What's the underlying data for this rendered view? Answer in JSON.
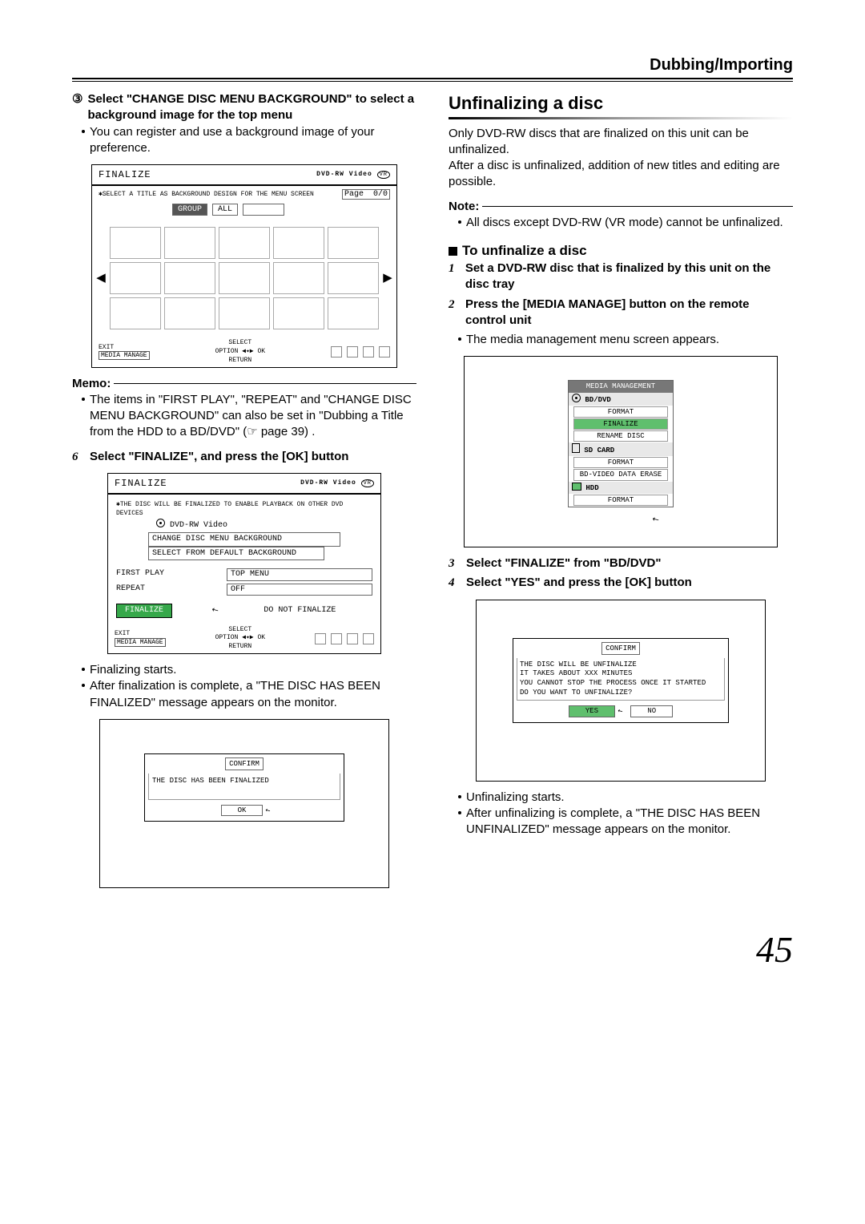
{
  "header": {
    "section": "Dubbing/Importing"
  },
  "left": {
    "step3_num": "③",
    "step3_text": "Select \"CHANGE DISC MENU BACKGROUND\" to  select a background image for the top menu",
    "step3_note": "You can register and use a background image of your preference.",
    "shot1": {
      "title": "FINALIZE",
      "badge": "DVD-RW Video",
      "note": "✱SELECT A TITLE AS BACKGROUND DESIGN FOR THE MENU SCREEN",
      "groupBtn": "GROUP",
      "allBtn": "ALL",
      "pageLabel": "Page",
      "pageVal": "0/0",
      "exit": "EXIT",
      "exitBtn": "MEDIA MANAGE",
      "select": "SELECT",
      "ok": "OK",
      "option": "OPTION",
      "ret": "RETURN"
    },
    "memo_label": "Memo:",
    "memo_text": "The items in \"FIRST PLAY\", \"REPEAT\" and \"CHANGE DISC MENU BACKGROUND\" can also be set in \"Dubbing a Title from the HDD to a BD/DVD\" (☞ page 39) .",
    "step6_num": "6",
    "step6_text": "Select \"FINALIZE\", and press the [OK] button",
    "shot2": {
      "title": "FINALIZE",
      "badge": "DVD-RW Video",
      "note": "✱THE DISC WILL BE FINALIZED TO ENABLE PLAYBACK ON OTHER DVD DEVICES",
      "disc": "DVD-RW Video",
      "bgLine1": "CHANGE DISC MENU BACKGROUND",
      "bgLine2": "SELECT FROM DEFAULT BACKGROUND",
      "firstPlayLbl": "FIRST PLAY",
      "firstPlayVal": "TOP MENU",
      "repeatLbl": "REPEAT",
      "repeatVal": "OFF",
      "finalizeBtn": "FINALIZE",
      "doNotFinalize": "DO NOT FINALIZE",
      "exit": "EXIT",
      "exitBtn": "MEDIA MANAGE",
      "select": "SELECT",
      "ok": "OK",
      "option": "OPTION",
      "ret": "RETURN"
    },
    "after6a": "Finalizing starts.",
    "after6b": "After finalization is complete, a \"THE DISC HAS BEEN FINALIZED\" message appears on the monitor.",
    "shot3": {
      "title": "CONFIRM",
      "msg": "THE DISC HAS BEEN FINALIZED",
      "ok": "OK"
    }
  },
  "right": {
    "h2": "Unfinalizing a disc",
    "p1": "Only DVD-RW discs that are finalized on this unit can be unfinalized.",
    "p2": "After a disc is unfinalized, addition of new titles and editing are possible.",
    "note_label": "Note:",
    "note_text": "All discs except DVD-RW (VR mode) cannot be unfinalized.",
    "subhead": "To unfinalize a disc",
    "s1": "Set a DVD-RW disc that is finalized by this unit on the disc tray",
    "s2": "Press the [MEDIA MANAGE] button on the remote control unit",
    "s2_after": "The media management menu screen appears.",
    "mm": {
      "header": "MEDIA MANAGEMENT",
      "g1": "BD/DVD",
      "g1a": "FORMAT",
      "g1b": "FINALIZE",
      "g1c": "RENAME DISC",
      "g2": "SD CARD",
      "g2a": "FORMAT",
      "g2b": "BD-VIDEO DATA ERASE",
      "g3": "HDD",
      "g3a": "FORMAT"
    },
    "s3": "Select \"FINALIZE\" from \"BD/DVD\"",
    "s4": "Select \"YES\" and press the [OK] button",
    "confirm": {
      "title": "CONFIRM",
      "l1": "THE DISC WILL BE UNFINALIZE",
      "l2": "IT TAKES ABOUT XXX MINUTES",
      "l3": "YOU CANNOT STOP THE PROCESS ONCE IT STARTED",
      "l4": "DO YOU WANT TO UNFINALIZE?",
      "yes": "YES",
      "no": "NO"
    },
    "after_a": "Unfinalizing starts.",
    "after_b": "After unfinalizing is complete, a \"THE DISC HAS BEEN UNFINALIZED\" message appears on the monitor."
  },
  "page_number": "45"
}
